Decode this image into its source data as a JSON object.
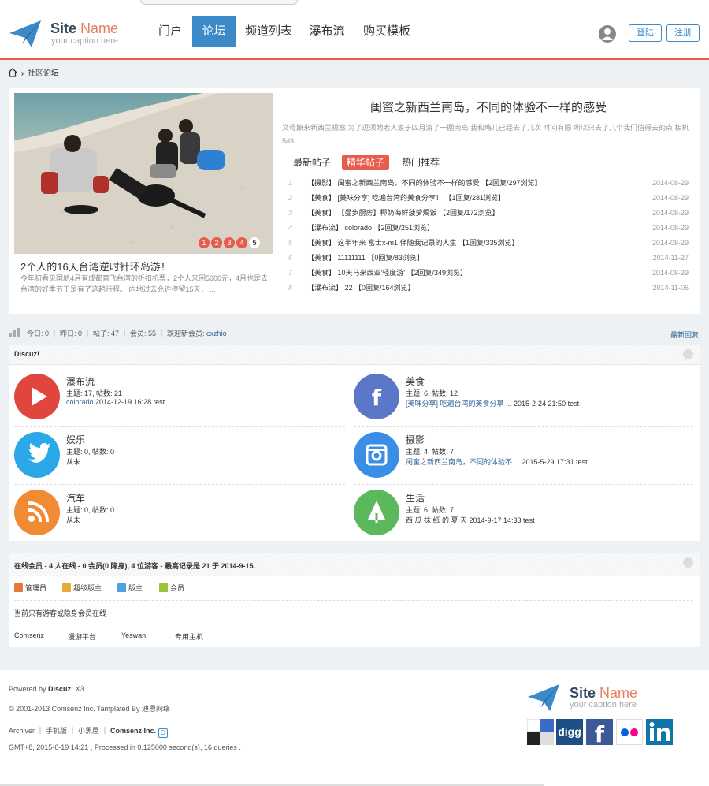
{
  "header": {
    "logo_site": "Site",
    "logo_name": "Name",
    "logo_caption": "your caption here",
    "nav": [
      "门户",
      "论坛",
      "频道列表",
      "瀑布流",
      "购买模板"
    ],
    "login": "登陆",
    "register": "注册"
  },
  "breadcrumb": {
    "label": "社区论坛"
  },
  "slider": {
    "title": "2个人的16天台湾逆时针环岛游！",
    "desc": "今年初看见国航4月有成都直飞台湾的折扣机票，2个人来回5000元，4月也是去台湾的好季节于是有了这趟行程。 内地过去允许停留15天， ...",
    "pages": [
      "1",
      "2",
      "3",
      "4",
      "5"
    ]
  },
  "featured": {
    "title": "闺蜜之新西兰南岛，不同的体验不一样的感受",
    "desc": "文母娘来新西兰视察 为了逗须她老人家于四月游了一圈南岛 我和略儿已经去了几次 时间有限 所以只去了几个我们值得去的点 相机5d3 ..."
  },
  "tabs": [
    "最新帖子",
    "精华帖子",
    "热门推荐"
  ],
  "threads": [
    {
      "num": "1",
      "text": "【摄影】 闺蜜之新西兰南岛，不同的体验不一样的感受 【2回复/297浏览】",
      "date": "2014-08-29"
    },
    {
      "num": "2",
      "text": "【美食】 [美味分享] 吃遍台湾的美食分享！ 【1回复/281浏览】",
      "date": "2014-08-29"
    },
    {
      "num": "3",
      "text": "【美食】 【曼步厨房】椰奶海鲜菠萝焗饭 【2回复/172浏览】",
      "date": "2014-08-29"
    },
    {
      "num": "4",
      "text": "【瀑布流】 colorado 【2回复/251浏览】",
      "date": "2014-08-29"
    },
    {
      "num": "5",
      "text": "【美食】 这半年来 富士x-m1 伴随我记录的人生 【1回复/335浏览】",
      "date": "2014-08-29"
    },
    {
      "num": "6",
      "text": "【美食】 11111111 【0回复/83浏览】",
      "date": "2014-11-27"
    },
    {
      "num": "7",
      "text": "【美食】 10天马来西亚'轻度游' 【2回复/349浏览】",
      "date": "2014-08-29"
    },
    {
      "num": "8",
      "text": "【瀑布流】 22 【0回复/164浏览】",
      "date": "2014-11-06"
    }
  ],
  "stats": {
    "text": "今日: 0 ｜ 昨日: 0 ｜ 帖子: 47 ｜ 会员: 55 ｜ 欢迎新会员:",
    "newmember": "cxzhio",
    "newreply": "最新回复"
  },
  "forum_section": {
    "title": "Discuz!"
  },
  "forums": [
    {
      "name": "瀑布流",
      "meta": "主题: 17, 帖数: 21",
      "last_link": "colorado",
      "last_rest": " 2014-12-19 16:28 test",
      "color": "#e0463d",
      "icon": "play-icon"
    },
    {
      "name": "美食",
      "meta": "主题: 6, 帖数: 12",
      "last_link": "[美味分享] 吃遍台湾的美食分享 ...",
      "last_rest": " 2015-2-24 21:50 test",
      "color": "#5b77c8",
      "icon": "facebook-icon"
    },
    {
      "name": "娱乐",
      "meta": "主题: 0, 帖数: 0",
      "last_link": "",
      "last_rest": "从未",
      "color": "#2aa8e8",
      "icon": "twitter-icon"
    },
    {
      "name": "摄影",
      "meta": "主题: 4, 帖数: 7",
      "last_link": "闺蜜之新西兰南岛，不同的体验不 ...",
      "last_rest": " 2015-5-29 17:31 test",
      "color": "#3a8ee6",
      "icon": "instagram-icon"
    },
    {
      "name": "汽车",
      "meta": "主题: 0, 帖数: 0",
      "last_link": "",
      "last_rest": "从未",
      "color": "#f08a33",
      "icon": "rss-icon"
    },
    {
      "name": "生活",
      "meta": "主题: 6, 帖数: 7",
      "last_link": "",
      "last_rest": "西 瓜 抹 纸 的 夏 天 2014-9-17 14:33 test",
      "color": "#5cb85c",
      "icon": "tree-icon"
    }
  ],
  "online": {
    "title": "在线会员 - 4 人在线 - 0 会员(0 隐身), 4 位游客 - 最高记录是 21 于 2014-9-15.",
    "legend": [
      {
        "label": "管理员",
        "color": "#e8763a"
      },
      {
        "label": "超级版主",
        "color": "#e8a93a"
      },
      {
        "label": "版主",
        "color": "#4aa3df"
      },
      {
        "label": "会员",
        "color": "#9bc23c"
      }
    ],
    "notice": "当前只有游客或隐身会员在线",
    "links": [
      "Comsenz",
      "漫游平台",
      "Yeswan",
      "专用主机"
    ]
  },
  "footer": {
    "powered_prefix": "Powered by",
    "powered_brand": "Discuz!",
    "powered_ver": "X3",
    "copyright": "© 2001-2013 Comsenz Inc. Tamplated By 迪恩网络",
    "links": "Archiver ｜ 手机版 ｜ 小黑屋 ｜",
    "company": "Comsenz Inc.",
    "gmt": "GMT+8, 2015-6-19 14:21 , Processed in 0.125000 second(s), 16 queries .",
    "social_digg": "digg"
  }
}
